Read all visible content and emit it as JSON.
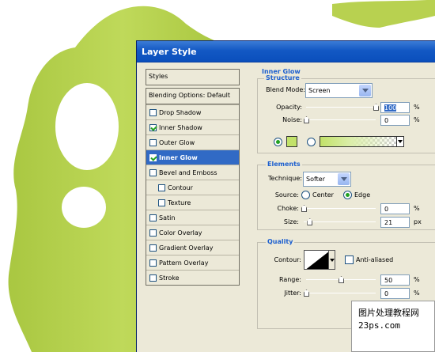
{
  "dialog": {
    "title": "Layer Style"
  },
  "styles_panel": {
    "header": "Styles",
    "blending_options": "Blending Options: Default",
    "items": [
      {
        "label": "Drop Shadow",
        "checked": false,
        "sub": false,
        "selected": false
      },
      {
        "label": "Inner Shadow",
        "checked": true,
        "sub": false,
        "selected": false
      },
      {
        "label": "Outer Glow",
        "checked": false,
        "sub": false,
        "selected": false
      },
      {
        "label": "Inner Glow",
        "checked": true,
        "sub": false,
        "selected": true
      },
      {
        "label": "Bevel and Emboss",
        "checked": false,
        "sub": false,
        "selected": false
      },
      {
        "label": "Contour",
        "checked": false,
        "sub": true,
        "selected": false
      },
      {
        "label": "Texture",
        "checked": false,
        "sub": true,
        "selected": false
      },
      {
        "label": "Satin",
        "checked": false,
        "sub": false,
        "selected": false
      },
      {
        "label": "Color Overlay",
        "checked": false,
        "sub": false,
        "selected": false
      },
      {
        "label": "Gradient Overlay",
        "checked": false,
        "sub": false,
        "selected": false
      },
      {
        "label": "Pattern Overlay",
        "checked": false,
        "sub": false,
        "selected": false
      },
      {
        "label": "Stroke",
        "checked": false,
        "sub": false,
        "selected": false
      }
    ]
  },
  "inner_glow": {
    "title": "Inner Glow",
    "structure": {
      "title": "Structure",
      "blend_mode_label": "Blend Mode:",
      "blend_mode_value": "Screen",
      "opacity_label": "Opacity:",
      "opacity_value": "100",
      "opacity_level": 1.0,
      "noise_label": "Noise:",
      "noise_value": "0",
      "noise_level": 0.0,
      "percent": "%",
      "glow_color": "#c2e26a"
    },
    "elements": {
      "title": "Elements",
      "technique_label": "Technique:",
      "technique_value": "Softer",
      "source_label": "Source:",
      "source_center": "Center",
      "source_edge": "Edge",
      "choke_label": "Choke:",
      "choke_value": "0",
      "choke_level": 0.0,
      "size_label": "Size:",
      "size_value": "21",
      "size_level": 0.08,
      "percent": "%",
      "px": "px"
    },
    "quality": {
      "title": "Quality",
      "contour_label": "Contour:",
      "anti_aliased": "Anti-aliased",
      "range_label": "Range:",
      "range_value": "50",
      "range_level": 0.5,
      "jitter_label": "Jitter:",
      "jitter_value": "0",
      "jitter_level": 0.0,
      "percent": "%"
    }
  },
  "watermark": {
    "line1": "图片处理教程网",
    "line2": "23ps.com"
  },
  "colors": {
    "title_bar": "#1358c4",
    "selection": "#316ac5",
    "section_title": "#1c5fcf",
    "lime": "#a6c83a"
  }
}
